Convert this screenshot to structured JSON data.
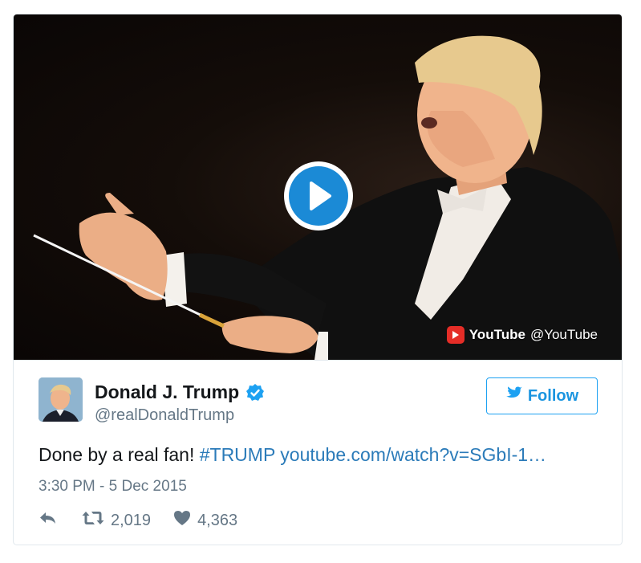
{
  "media": {
    "attribution_brand": "YouTube",
    "attribution_handle": "@YouTube"
  },
  "author": {
    "display_name": "Donald J. Trump",
    "handle": "@realDonaldTrump",
    "verified": true
  },
  "follow_button": {
    "label": "Follow"
  },
  "tweet": {
    "text": "Done by a real fan!",
    "hashtag": "#TRUMP",
    "link": "youtube.com/watch?v=SGbI-1…",
    "timestamp": "3:30 PM - 5 Dec 2015"
  },
  "stats": {
    "retweets": "2,019",
    "likes": "4,363"
  },
  "colors": {
    "accent": "#1da1f2",
    "link": "#2b7bb9",
    "muted": "#657786",
    "play_button": "#1b8ad6",
    "youtube_red": "#e52d27"
  },
  "icons": [
    "play-icon",
    "youtube-icon",
    "verified-icon",
    "twitter-bird-icon",
    "reply-icon",
    "retweet-icon",
    "heart-icon"
  ]
}
